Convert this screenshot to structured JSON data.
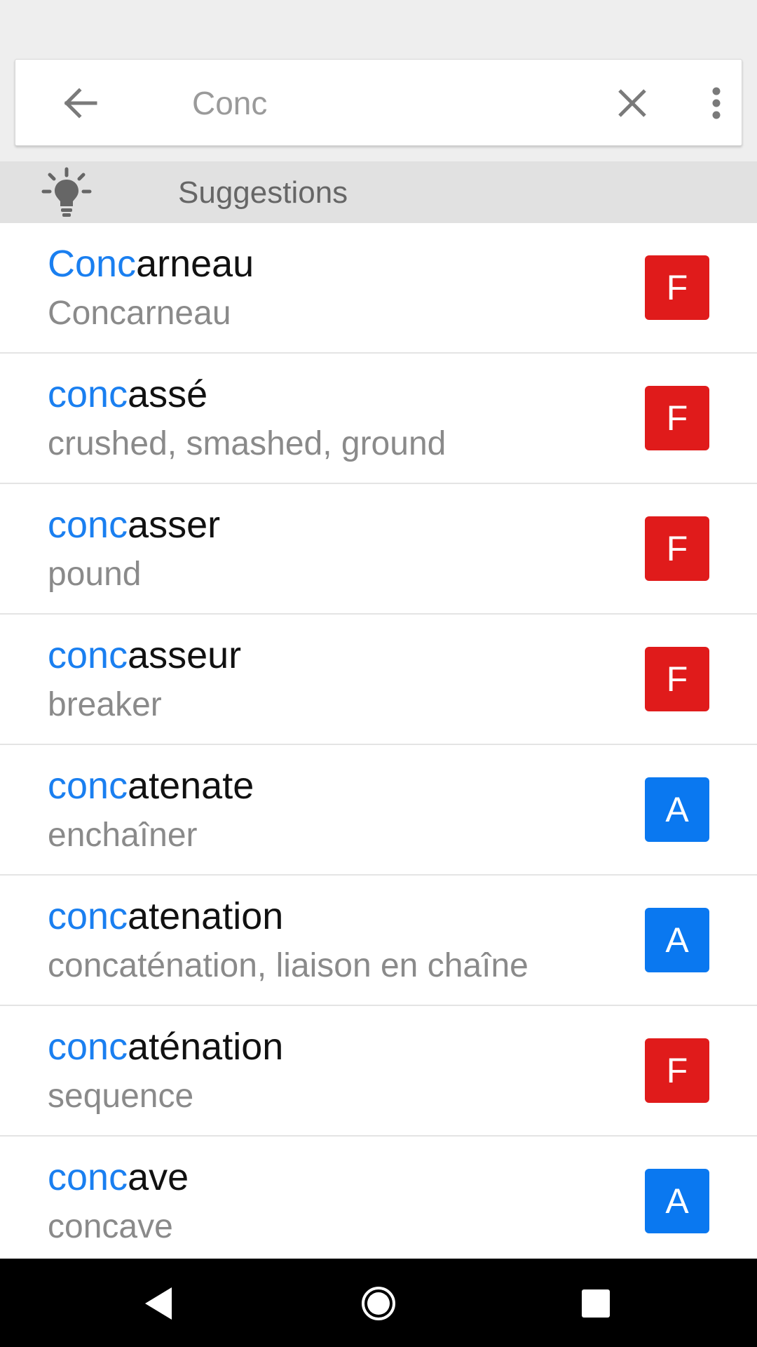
{
  "search": {
    "query": "Conc",
    "back_icon": "arrow-left-icon",
    "clear_icon": "close-icon",
    "menu_icon": "more-vert-icon"
  },
  "suggestions_header": {
    "label": "Suggestions",
    "icon": "lightbulb-icon"
  },
  "colors": {
    "highlight": "#1a7ff0",
    "badge_F": "#e01b1b",
    "badge_A": "#0a78f0"
  },
  "results": [
    {
      "prefix": "Conc",
      "rest": "arneau",
      "translation": "Concarneau",
      "lang": "F"
    },
    {
      "prefix": "conc",
      "rest": "assé",
      "translation": "crushed, smashed, ground",
      "lang": "F"
    },
    {
      "prefix": "conc",
      "rest": "asser",
      "translation": "pound",
      "lang": "F"
    },
    {
      "prefix": "conc",
      "rest": "asseur",
      "translation": "breaker",
      "lang": "F"
    },
    {
      "prefix": "conc",
      "rest": "atenate",
      "translation": "enchaîner",
      "lang": "A"
    },
    {
      "prefix": "conc",
      "rest": "atenation",
      "translation": "concaténation, liaison en chaîne",
      "lang": "A"
    },
    {
      "prefix": "conc",
      "rest": "aténation",
      "translation": "sequence",
      "lang": "F"
    },
    {
      "prefix": "conc",
      "rest": "ave",
      "translation": "concave",
      "lang": "A"
    }
  ],
  "navbar": {
    "back_icon": "nav-back-icon",
    "home_icon": "nav-home-icon",
    "recents_icon": "nav-recents-icon"
  }
}
